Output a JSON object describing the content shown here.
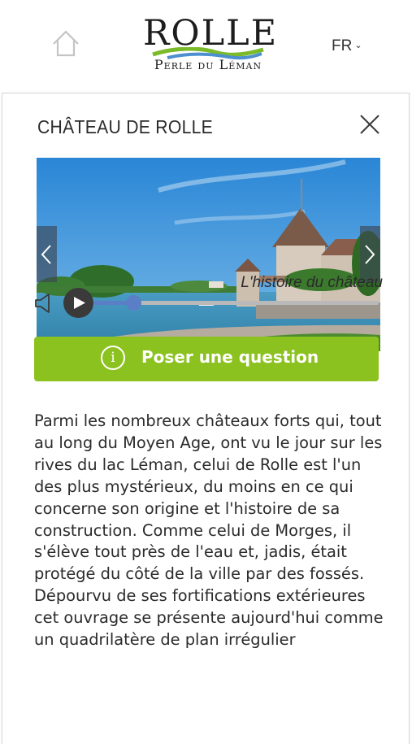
{
  "header": {
    "logo": {
      "title": "ROLLE",
      "subtitle": "Perle du Léman",
      "wave_colors": [
        "#7bbb2a",
        "#4e8fd0"
      ]
    },
    "home_icon": "home-icon",
    "language": {
      "selected": "FR",
      "icon": "chevron-down-icon"
    }
  },
  "panel": {
    "title": "CHÂTEAU DE ROLLE",
    "close_icon": "close-icon",
    "carousel": {
      "prev_icon": "chevron-left-icon",
      "next_icon": "chevron-right-icon"
    },
    "audio": {
      "track_title": "L'histoire du château",
      "volume_icon": "volume-icon",
      "play_icon": "play-icon",
      "progress": 0.14,
      "accent_color": "#5b7fc6"
    },
    "ask_button": {
      "label": "Poser une question",
      "icon": "info-icon",
      "color": "#8cc21f"
    },
    "description": "Parmi les nombreux châteaux forts qui, tout au long du Moyen Age, ont vu le jour sur les rives du lac Léman, celui de Rolle est l'un des plus mystérieux, du moins en ce qui concerne son origine et l'histoire de sa construction. Comme celui de Morges, il s'élève tout près de l'eau et, jadis, était protégé du côté de la ville par des fossés. Dépourvu de ses fortifications extérieures cet ouvrage se présente aujourd'hui comme un quadrilatère de plan irrégulier"
  }
}
